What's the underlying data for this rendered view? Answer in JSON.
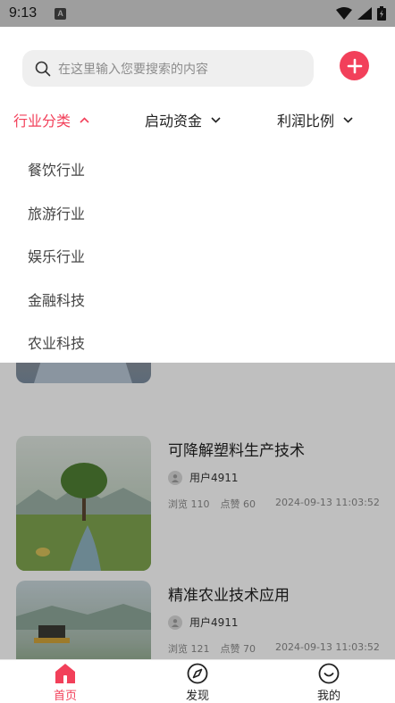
{
  "status_bar": {
    "time": "9:13",
    "sim_label": "A"
  },
  "search": {
    "placeholder": "在这里输入您要搜索的内容"
  },
  "filters": [
    {
      "label": "行业分类",
      "active": true
    },
    {
      "label": "启动资金",
      "active": false
    },
    {
      "label": "利润比例",
      "active": false
    }
  ],
  "dropdown": {
    "items": [
      "餐饮行业",
      "旅游行业",
      "娱乐行业",
      "金融科技",
      "农业科技"
    ]
  },
  "posts": [
    {
      "title": "可降解塑料生产技术",
      "author": "用户4911",
      "views_label": "浏览 110",
      "likes_label": "点赞 60",
      "date": "2024-09-13 11:03:52"
    },
    {
      "title": "精准农业技术应用",
      "author": "用户4911",
      "views_label": "浏览 121",
      "likes_label": "点赞 70",
      "date": "2024-09-13 11:03:52"
    }
  ],
  "tabs": [
    {
      "label": "首页",
      "icon": "home-icon",
      "active": true
    },
    {
      "label": "发现",
      "icon": "compass-icon",
      "active": false
    },
    {
      "label": "我的",
      "icon": "smile-icon",
      "active": false
    }
  ],
  "colors": {
    "accent": "#f2405a",
    "status_bar": "#9e9e9e",
    "search_bg": "#efefef"
  }
}
